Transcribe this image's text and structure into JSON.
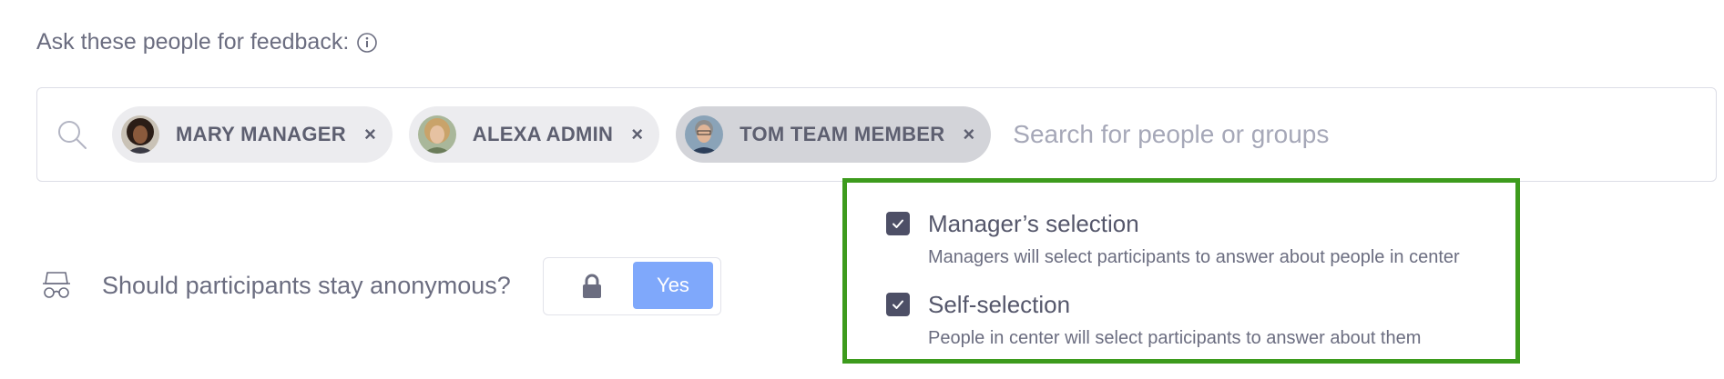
{
  "feedback": {
    "heading": "Ask these people for feedback:",
    "info_icon": "info-icon",
    "search_icon": "search-icon",
    "search_placeholder": "Search for people or groups",
    "search_value": "",
    "chips": [
      {
        "name": "MARY MANAGER",
        "remove": "×",
        "avatar": "avatar-woman-curly-hair"
      },
      {
        "name": "ALEXA ADMIN",
        "remove": "×",
        "avatar": "avatar-woman-blonde"
      },
      {
        "name": "TOM TEAM MEMBER",
        "remove": "×",
        "avatar": "avatar-man-glasses"
      }
    ]
  },
  "anonymous": {
    "icon": "glasses-icon",
    "label": "Should participants stay anonymous?",
    "lock_icon": "lock-icon",
    "yes_label": "Yes"
  },
  "dropdown": {
    "options": [
      {
        "title": "Manager’s selection",
        "description": "Managers will select participants to answer about people in center",
        "checked": true
      },
      {
        "title": "Self-selection",
        "description": "People in center will select participants to answer about them",
        "checked": true
      }
    ]
  },
  "colors": {
    "accent": "#7fa8fb",
    "highlight_border": "#3d9b1d",
    "checkbox": "#4d4f66",
    "text": "#4b4d63"
  }
}
